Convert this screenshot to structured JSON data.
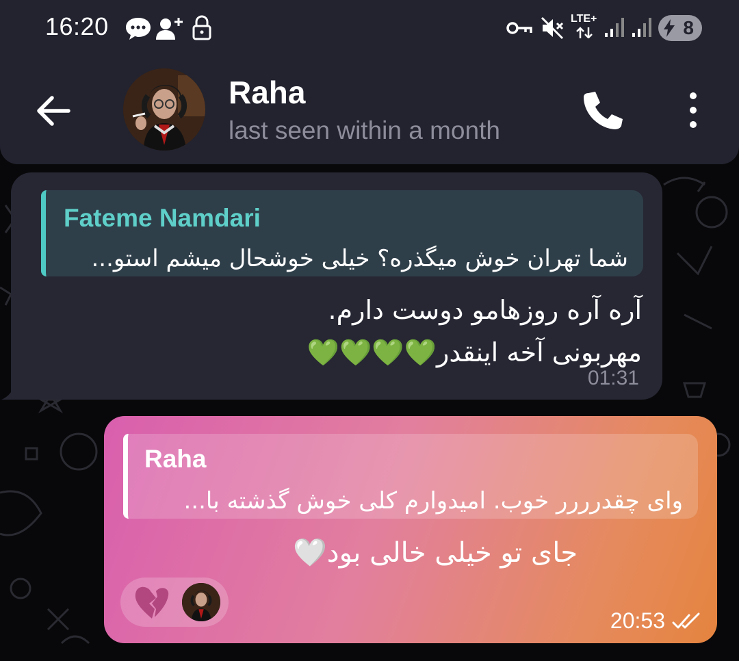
{
  "status_bar": {
    "time": "16:20",
    "network": "LTE+",
    "battery": "8",
    "icons": [
      "message-bubble-icon",
      "add-person-icon",
      "lock-icon",
      "key-icon",
      "mute-icon",
      "signal-icon",
      "signal-icon",
      "battery-charging-icon"
    ]
  },
  "header": {
    "back_icon": "arrow-left-icon",
    "name": "Raha",
    "status": "last seen within a month",
    "call_icon": "phone-icon",
    "menu_icon": "more-vert-icon"
  },
  "messages": [
    {
      "direction": "incoming",
      "reply": {
        "name": "Fateme Namdari",
        "text": "شما تهران خوش میگذره؟ خیلی خوشحال میشم استو..."
      },
      "lines": [
        "آره آره روزهامو دوست دارم.",
        "مهربونی آخه اینقدر💚💚💚💚"
      ],
      "time": "01:31",
      "accent": "#5fd0c9"
    },
    {
      "direction": "outgoing",
      "reply": {
        "name": "Raha",
        "text": "وای چقدرررر خوب. امیدوارم کلی خوش گذشته با..."
      },
      "text": "جای تو خیلی خالی بود🤍",
      "reaction": "broken-heart",
      "time": "20:53",
      "status_icon": "double-check-icon"
    }
  ]
}
